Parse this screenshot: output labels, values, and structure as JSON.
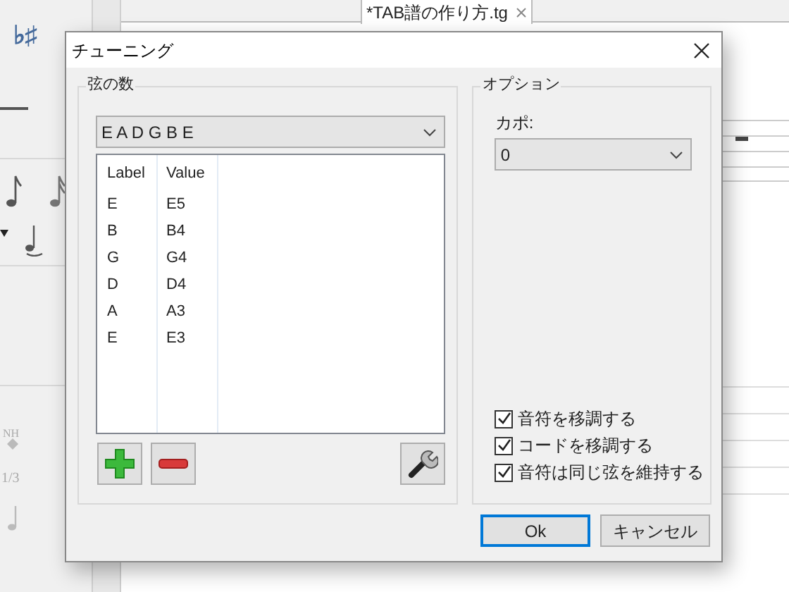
{
  "app": {
    "accidental_button": "♭♯",
    "harmonic_label": "NH",
    "tuplet_label": "1/3",
    "tabs": [
      {
        "label": "*TAB譜の作り方.tg",
        "selected": true
      }
    ]
  },
  "dialog": {
    "title": "チューニング",
    "strings_group": {
      "title": "弦の数",
      "preset": "E A D G B E",
      "table": {
        "columns": [
          "Label",
          "Value"
        ],
        "rows": [
          {
            "label": "E",
            "value": "E5"
          },
          {
            "label": "B",
            "value": "B4"
          },
          {
            "label": "G",
            "value": "G4"
          },
          {
            "label": "D",
            "value": "D4"
          },
          {
            "label": "A",
            "value": "A3"
          },
          {
            "label": "E",
            "value": "E3"
          }
        ]
      }
    },
    "options_group": {
      "title": "オプション",
      "capo_label": "カポ:",
      "capo_value": "0",
      "checkboxes": [
        {
          "label": "音符を移調する",
          "checked": true
        },
        {
          "label": "コードを移調する",
          "checked": true
        },
        {
          "label": "音符は同じ弦を維持する",
          "checked": true
        }
      ]
    },
    "buttons": [
      {
        "label": "Ok",
        "default": true
      },
      {
        "label": "キャンセル",
        "default": false
      }
    ]
  }
}
